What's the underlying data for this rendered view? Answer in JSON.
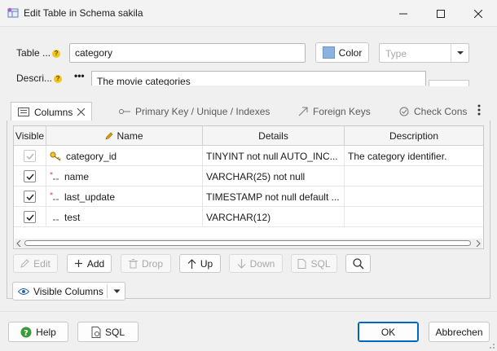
{
  "window": {
    "title": "Edit Table in Schema sakila",
    "controls": [
      "minimize-icon",
      "maximize-icon",
      "close-icon"
    ]
  },
  "form": {
    "table_label": "Table ...",
    "table_value": "category",
    "color_button": "Color",
    "color_swatch": "#8cb3e0",
    "type_placeholder": "Type",
    "description_label": "Descri...",
    "description_value": "The movie categories",
    "more_label": "•••"
  },
  "tabs": [
    {
      "label": "Columns",
      "active": true
    },
    {
      "label": "Primary Key / Unique / Indexes"
    },
    {
      "label": "Foreign Keys"
    },
    {
      "label": "Check Cons"
    }
  ],
  "grid": {
    "headers": [
      "Visible",
      "Name",
      "Details",
      "Description"
    ],
    "rows": [
      {
        "name": "category_id",
        "details": "TINYINT not null AUTO_INC...",
        "description": "The category identifier.",
        "icon": "primary-key-icon",
        "checked": true,
        "disabled": true
      },
      {
        "name": "name",
        "details": "VARCHAR(25) not null",
        "description": "",
        "icon": "not-null-column-icon",
        "checked": true,
        "disabled": false
      },
      {
        "name": "last_update",
        "details": "TIMESTAMP not null default ...",
        "description": "",
        "icon": "not-null-column-icon",
        "checked": true,
        "disabled": false
      },
      {
        "name": "test",
        "details": "VARCHAR(12)",
        "description": "",
        "icon": "column-icon",
        "checked": true,
        "disabled": false
      }
    ]
  },
  "toolbar": {
    "edit": "Edit",
    "add": "Add",
    "drop": "Drop",
    "up": "Up",
    "down": "Down",
    "sql": "SQL"
  },
  "visible_columns": "Visible Columns",
  "footer": {
    "help": "Help",
    "sql": "SQL",
    "ok": "OK",
    "cancel": "Abbrechen"
  },
  "colors": {
    "accent": "#0067c0",
    "help_green": "#3a9a3a",
    "key_gold": "#e0a000"
  }
}
